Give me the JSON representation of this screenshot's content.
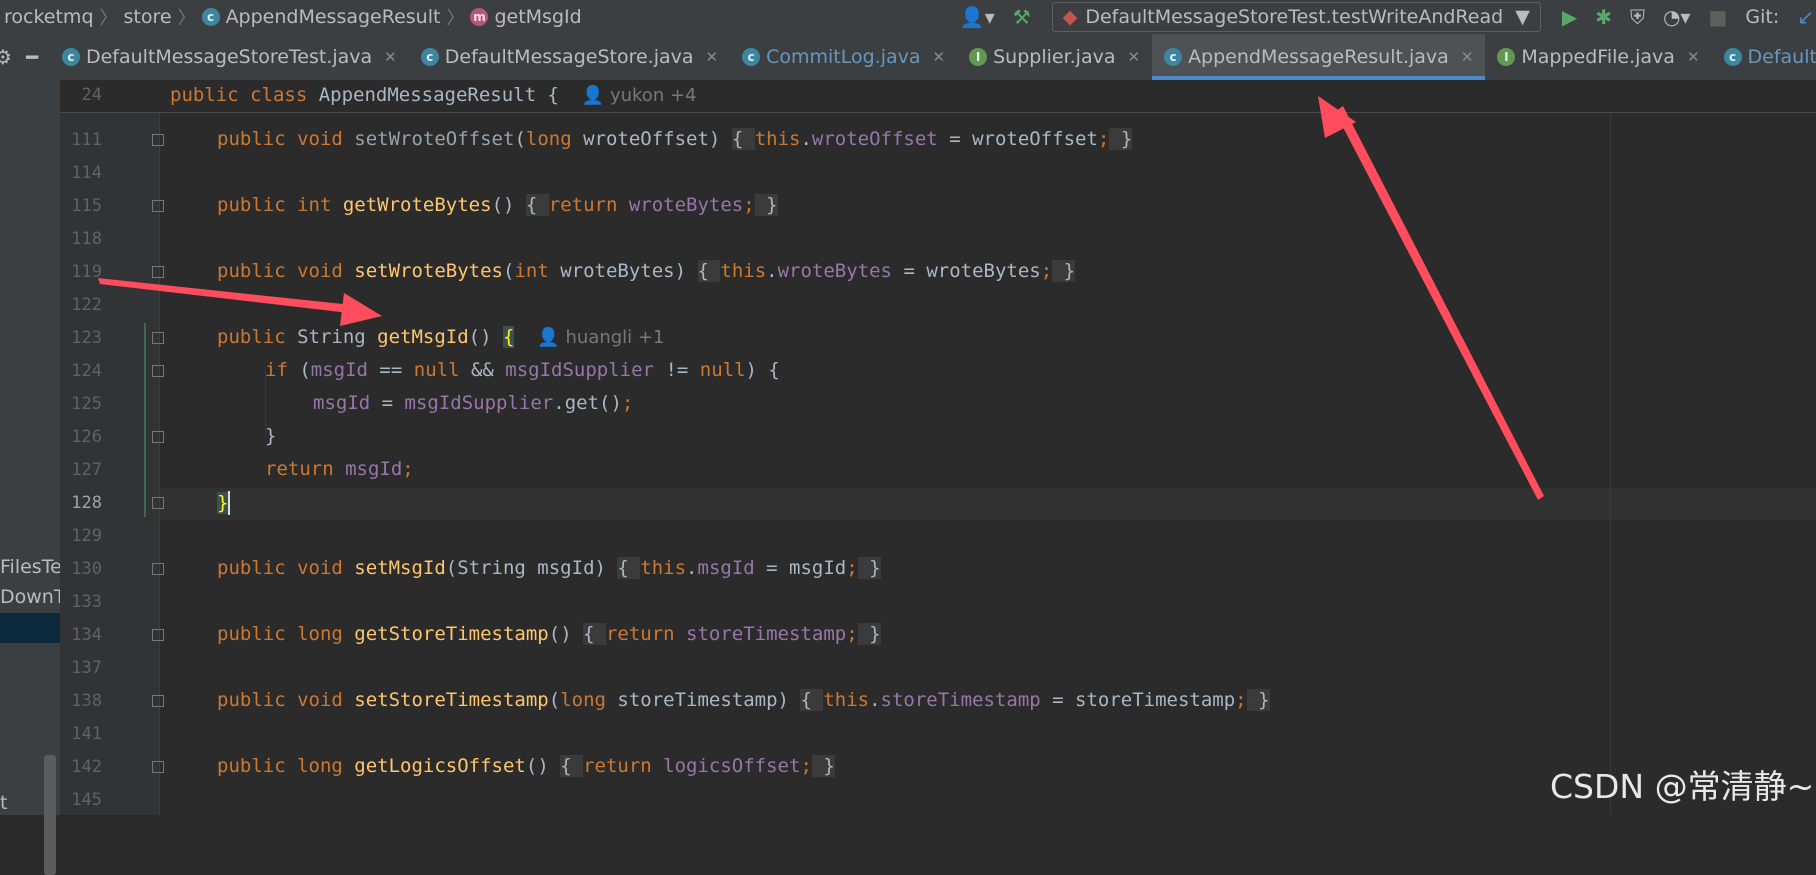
{
  "breadcrumb": {
    "items": [
      {
        "label": "rocketmq",
        "icon": ""
      },
      {
        "label": "store",
        "icon": ""
      },
      {
        "label": "AppendMessageResult",
        "icon": "class-icon"
      },
      {
        "label": "getMsgId",
        "icon": "method-icon"
      }
    ]
  },
  "toolbar": {
    "run_config": "DefaultMessageStoreTest.testWriteAndRead",
    "git_label": "Git:"
  },
  "tabs": [
    {
      "label": "DefaultMessageStoreTest.java",
      "icon": "class-icon",
      "color": "#bbbbbb",
      "active": false
    },
    {
      "label": "DefaultMessageStore.java",
      "icon": "class-icon",
      "color": "#bbbbbb",
      "active": false
    },
    {
      "label": "CommitLog.java",
      "icon": "class-icon",
      "color": "#6897bb",
      "active": false
    },
    {
      "label": "Supplier.java",
      "icon": "interface-icon",
      "color": "#bbbbbb",
      "active": false
    },
    {
      "label": "AppendMessageResult.java",
      "icon": "class-icon",
      "color": "#bbbbbb",
      "active": true
    },
    {
      "label": "MappedFile.java",
      "icon": "interface-icon",
      "color": "#bbbbbb",
      "active": false
    },
    {
      "label": "DefaultMapped",
      "icon": "class-icon",
      "color": "#6897bb",
      "active": false
    }
  ],
  "left_panel": {
    "items": [
      "FilesTe",
      "DownTe",
      "t"
    ]
  },
  "editor": {
    "sticky": {
      "line": "24",
      "code_kw": "public class ",
      "code_name": "AppendMessageResult {",
      "author": "yukon +4"
    },
    "line_numbers": [
      "111",
      "114",
      "115",
      "118",
      "119",
      "122",
      "123",
      "124",
      "125",
      "126",
      "127",
      "128",
      "129",
      "130",
      "133",
      "134",
      "137",
      "138",
      "141",
      "142",
      "145"
    ],
    "lines": {
      "l111": {
        "kw": "public void ",
        "name": "setWroteOffset",
        "p1": "(",
        "kw2": "long",
        "p2": " wroteOffset) ",
        "b1": "{ ",
        "kw3": "this",
        "dot": ".",
        "fld": "wroteOffset",
        "rest": " = wroteOffset",
        "semi": ";",
        "b2": " }"
      },
      "l115": {
        "kw": "public int ",
        "name": "getWroteBytes",
        "p1": "() ",
        "b1": "{ ",
        "kw2": "return ",
        "fld": "wroteBytes",
        "semi": ";",
        "b2": " }"
      },
      "l119": {
        "kw": "public void ",
        "name": "setWroteBytes",
        "p1": "(",
        "kw2": "int",
        "p2": " wroteBytes) ",
        "b1": "{ ",
        "kw3": "this",
        "dot": ".",
        "fld": "wroteBytes",
        "rest": " = wroteBytes",
        "semi": ";",
        "b2": " }"
      },
      "l123": {
        "kw": "public ",
        "type": "String ",
        "name": "getMsgId",
        "p1": "() ",
        "brace": "{",
        "author": "huangli +1"
      },
      "l124": {
        "kw": "if ",
        "p1": "(",
        "fld": "msgId",
        "op1": " == ",
        "kw2": "null",
        "op2": " && ",
        "fld2": "msgIdSupplier",
        "op3": " != ",
        "kw3": "null",
        "p2": ") {"
      },
      "l125": {
        "fld": "msgId",
        "op": " = ",
        "fld2": "msgIdSupplier",
        "call": ".get()",
        "semi": ";"
      },
      "l126": {
        "text": "}"
      },
      "l127": {
        "kw": "return ",
        "fld": "msgId",
        "semi": ";"
      },
      "l128": {
        "brace": "}"
      },
      "l130": {
        "kw": "public void ",
        "name": "setMsgId",
        "p1": "(String msgId) ",
        "b1": "{ ",
        "kw3": "this",
        "dot": ".",
        "fld": "msgId",
        "rest": " = msgId",
        "semi": ";",
        "b2": " }"
      },
      "l134": {
        "kw": "public long ",
        "name": "getStoreTimestamp",
        "p1": "() ",
        "b1": "{ ",
        "kw2": "return ",
        "fld": "storeTimestamp",
        "semi": ";",
        "b2": " }"
      },
      "l138": {
        "kw": "public void ",
        "name": "setStoreTimestamp",
        "p1": "(",
        "kw2": "long",
        "p2": " storeTimestamp) ",
        "b1": "{ ",
        "kw3": "this",
        "dot": ".",
        "fld": "storeTimestamp",
        "rest": " = storeTimestamp",
        "semi": ";",
        "b2": " }"
      },
      "l142": {
        "kw": "public long ",
        "name": "getLogicsOffset",
        "p1": "() ",
        "b1": "{ ",
        "kw2": "return ",
        "fld": "logicsOffset",
        "semi": ";",
        "b2": " }"
      }
    }
  },
  "watermark": "CSDN @常清静~",
  "colors": {
    "keyword": "#cc7832",
    "method": "#ffc66d",
    "field": "#9876aa",
    "annotation_arrow": "#ff4d5e",
    "active_tab_underline": "#4a88c7"
  }
}
